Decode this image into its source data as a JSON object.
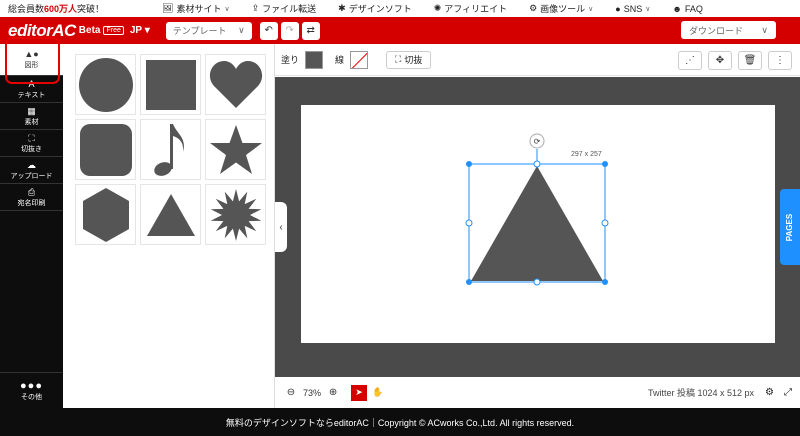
{
  "infobar": {
    "members_prefix": "総会員数",
    "members_count": "600万人",
    "members_suffix": "突破！",
    "nav": [
      {
        "label": "素材サイト",
        "icon": "image-icon"
      },
      {
        "label": "ファイル転送",
        "icon": "upload-icon"
      },
      {
        "label": "デザインソフト",
        "icon": "sparkle-icon"
      },
      {
        "label": "アフィリエイト",
        "icon": "sun-icon"
      },
      {
        "label": "画像ツール",
        "icon": "gears-icon"
      },
      {
        "label": "SNS",
        "icon": "chat-icon"
      },
      {
        "label": "FAQ",
        "icon": "person-icon"
      }
    ]
  },
  "header": {
    "logo": "editorAC",
    "beta": "Beta",
    "free": "Free",
    "lang": "JP",
    "template_label": "テンプレート",
    "download_label": "ダウンロード",
    "brand_color": "#d40000"
  },
  "sidebar": {
    "items": [
      {
        "label": "図形",
        "icon": "shapes-icon"
      },
      {
        "label": "テキスト",
        "icon": "text-icon"
      },
      {
        "label": "素材",
        "icon": "grid-icon"
      },
      {
        "label": "切抜き",
        "icon": "crop-icon"
      },
      {
        "label": "アップロード",
        "icon": "cloud-upload-icon"
      },
      {
        "label": "宛名印刷",
        "icon": "print-icon"
      }
    ],
    "more_label": "その他"
  },
  "shapes": [
    "circle",
    "square",
    "heart",
    "rounded-square",
    "music-note",
    "star",
    "hexagon",
    "triangle",
    "starburst"
  ],
  "toolbar": {
    "fill_label": "塗り",
    "stroke_label": "線",
    "cut_label": "切抜",
    "fill_color": "#555555"
  },
  "canvas": {
    "selection_size": "297 x 257"
  },
  "pages_label": "PAGES",
  "bottombar": {
    "zoom": "73%",
    "size_info": "Twitter 投稿 1024 x 512 px"
  },
  "footer": {
    "text": "無料のデザインソフトならeditorAC｜Copyright © ACworks Co.,Ltd. All rights reserved."
  }
}
